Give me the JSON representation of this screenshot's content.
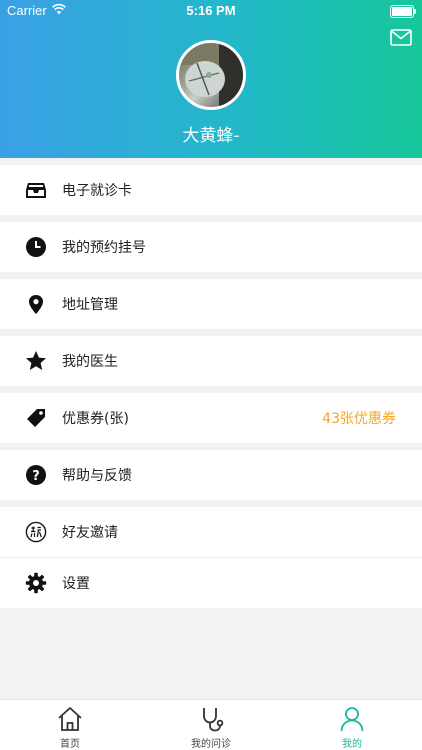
{
  "status_bar": {
    "carrier": "Carrier",
    "time": "5:16 PM"
  },
  "profile": {
    "username": "大黄蜂-"
  },
  "menu": {
    "items": [
      {
        "label": "电子就诊卡",
        "icon": "inbox-card-icon"
      },
      {
        "label": "我的预约挂号",
        "icon": "clock-icon"
      },
      {
        "label": "地址管理",
        "icon": "location-pin-icon"
      },
      {
        "label": "我的医生",
        "icon": "star-icon"
      },
      {
        "label": "优惠券(张)",
        "icon": "tag-icon",
        "value": "43张优惠券"
      },
      {
        "label": "帮助与反馈",
        "icon": "question-icon"
      },
      {
        "label": "好友邀请",
        "icon": "invite-icon"
      },
      {
        "label": "设置",
        "icon": "gear-icon"
      }
    ],
    "value_color": "#f5a623"
  },
  "tabbar": {
    "tabs": [
      {
        "label": "首页",
        "icon": "home-icon"
      },
      {
        "label": "我的问诊",
        "icon": "stethoscope-icon"
      },
      {
        "label": "我的",
        "icon": "person-icon",
        "active": true
      }
    ],
    "active_color": "#17b89a"
  },
  "colors": {
    "header_start": "#3aa0e6",
    "header_end": "#16c79a",
    "background": "#f2f2f2"
  }
}
